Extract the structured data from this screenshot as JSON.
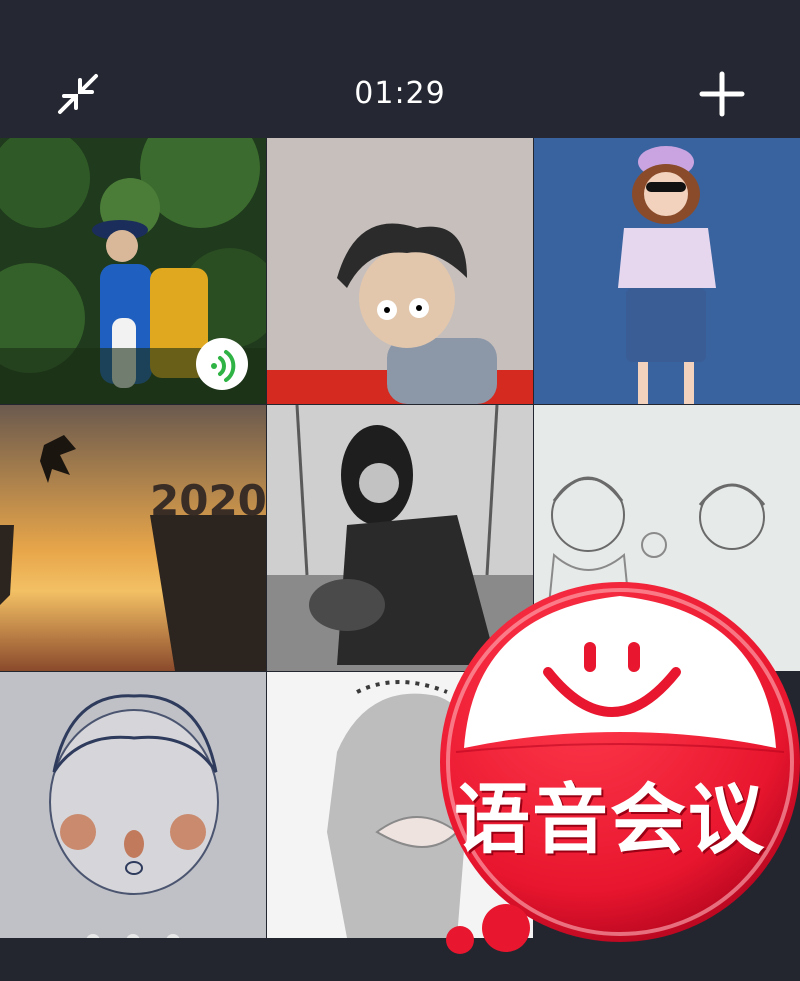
{
  "header": {
    "timer": "01:29",
    "left_icon": "minimize-arrows-icon",
    "right_icon": "plus-icon"
  },
  "participants": [
    {
      "name": "participant-hiker",
      "speaking": true
    },
    {
      "name": "participant-cartoon-boy"
    },
    {
      "name": "participant-cartoon-girl-sunglasses"
    },
    {
      "name": "participant-jump-2020",
      "image_text": "2020"
    },
    {
      "name": "participant-bw-woman"
    },
    {
      "name": "participant-sketch-couple"
    },
    {
      "name": "participant-sketch-boy",
      "connecting": true
    },
    {
      "name": "participant-sketch-girl"
    }
  ],
  "sticker": {
    "text": "语音会议",
    "color": "#e8162e"
  },
  "colors": {
    "background": "#23262f",
    "speaking_badge": "#2fb344"
  }
}
